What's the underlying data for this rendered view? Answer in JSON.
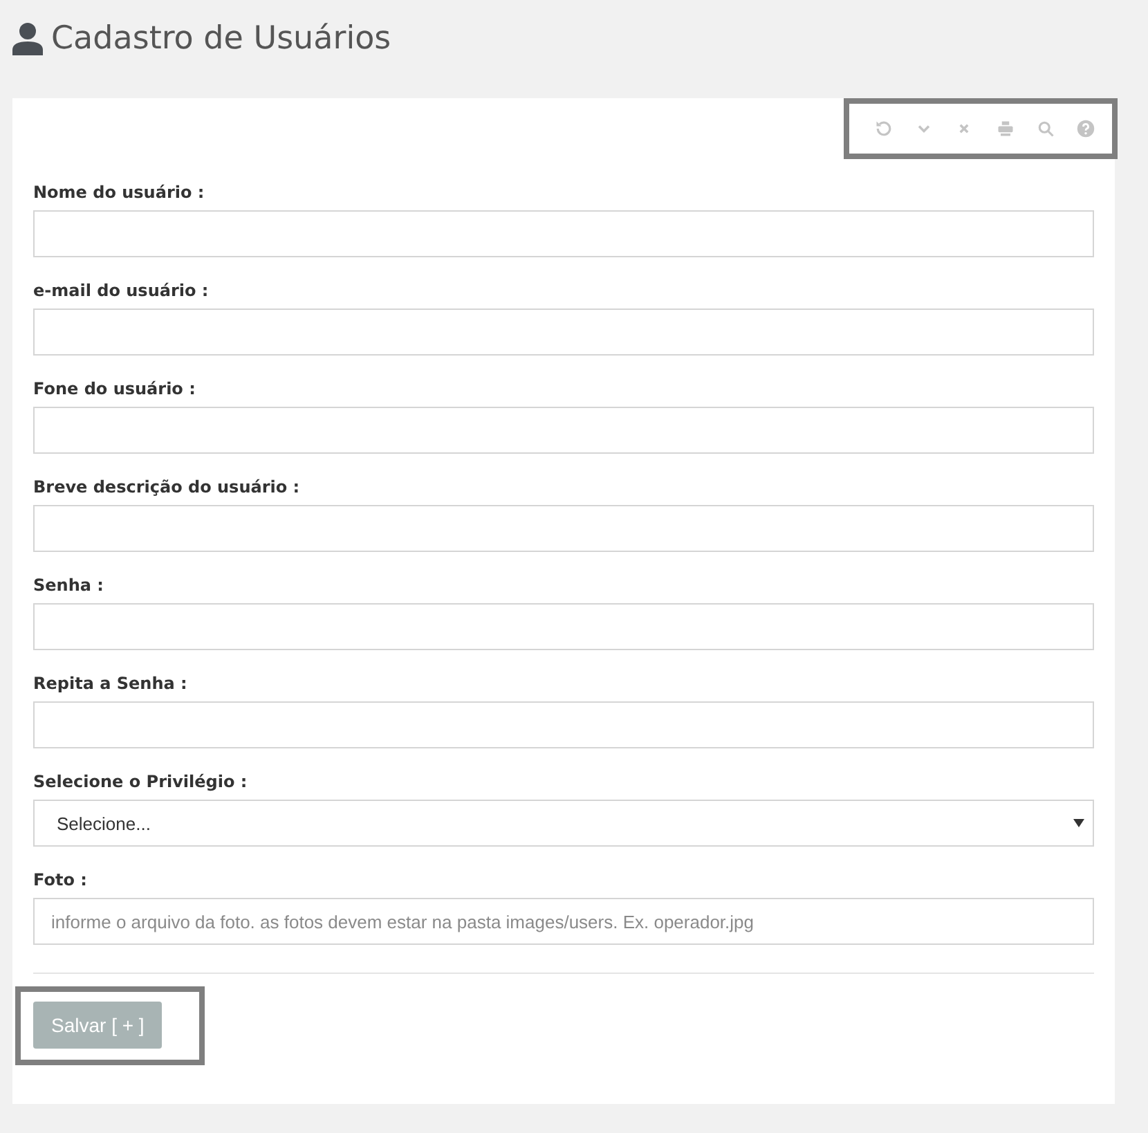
{
  "page_title": "Cadastro de Usuários",
  "fields": [
    {
      "label": "Nome do usuário :",
      "kind": "text"
    },
    {
      "label": "e-mail do usuário :",
      "kind": "text"
    },
    {
      "label": "Fone do usuário :",
      "kind": "text"
    },
    {
      "label": "Breve descrição do usuário :",
      "kind": "text"
    },
    {
      "label": "Senha :",
      "kind": "text"
    },
    {
      "label": "Repita a Senha :",
      "kind": "text"
    },
    {
      "label": "Selecione o Privilégio :",
      "kind": "select",
      "value": "Selecione..."
    },
    {
      "label": "Foto :",
      "kind": "text",
      "placeholder": "informe o arquivo da foto. as fotos devem estar na pasta images/users. Ex. operador.jpg"
    }
  ],
  "save_button": "Salvar [ + ]"
}
